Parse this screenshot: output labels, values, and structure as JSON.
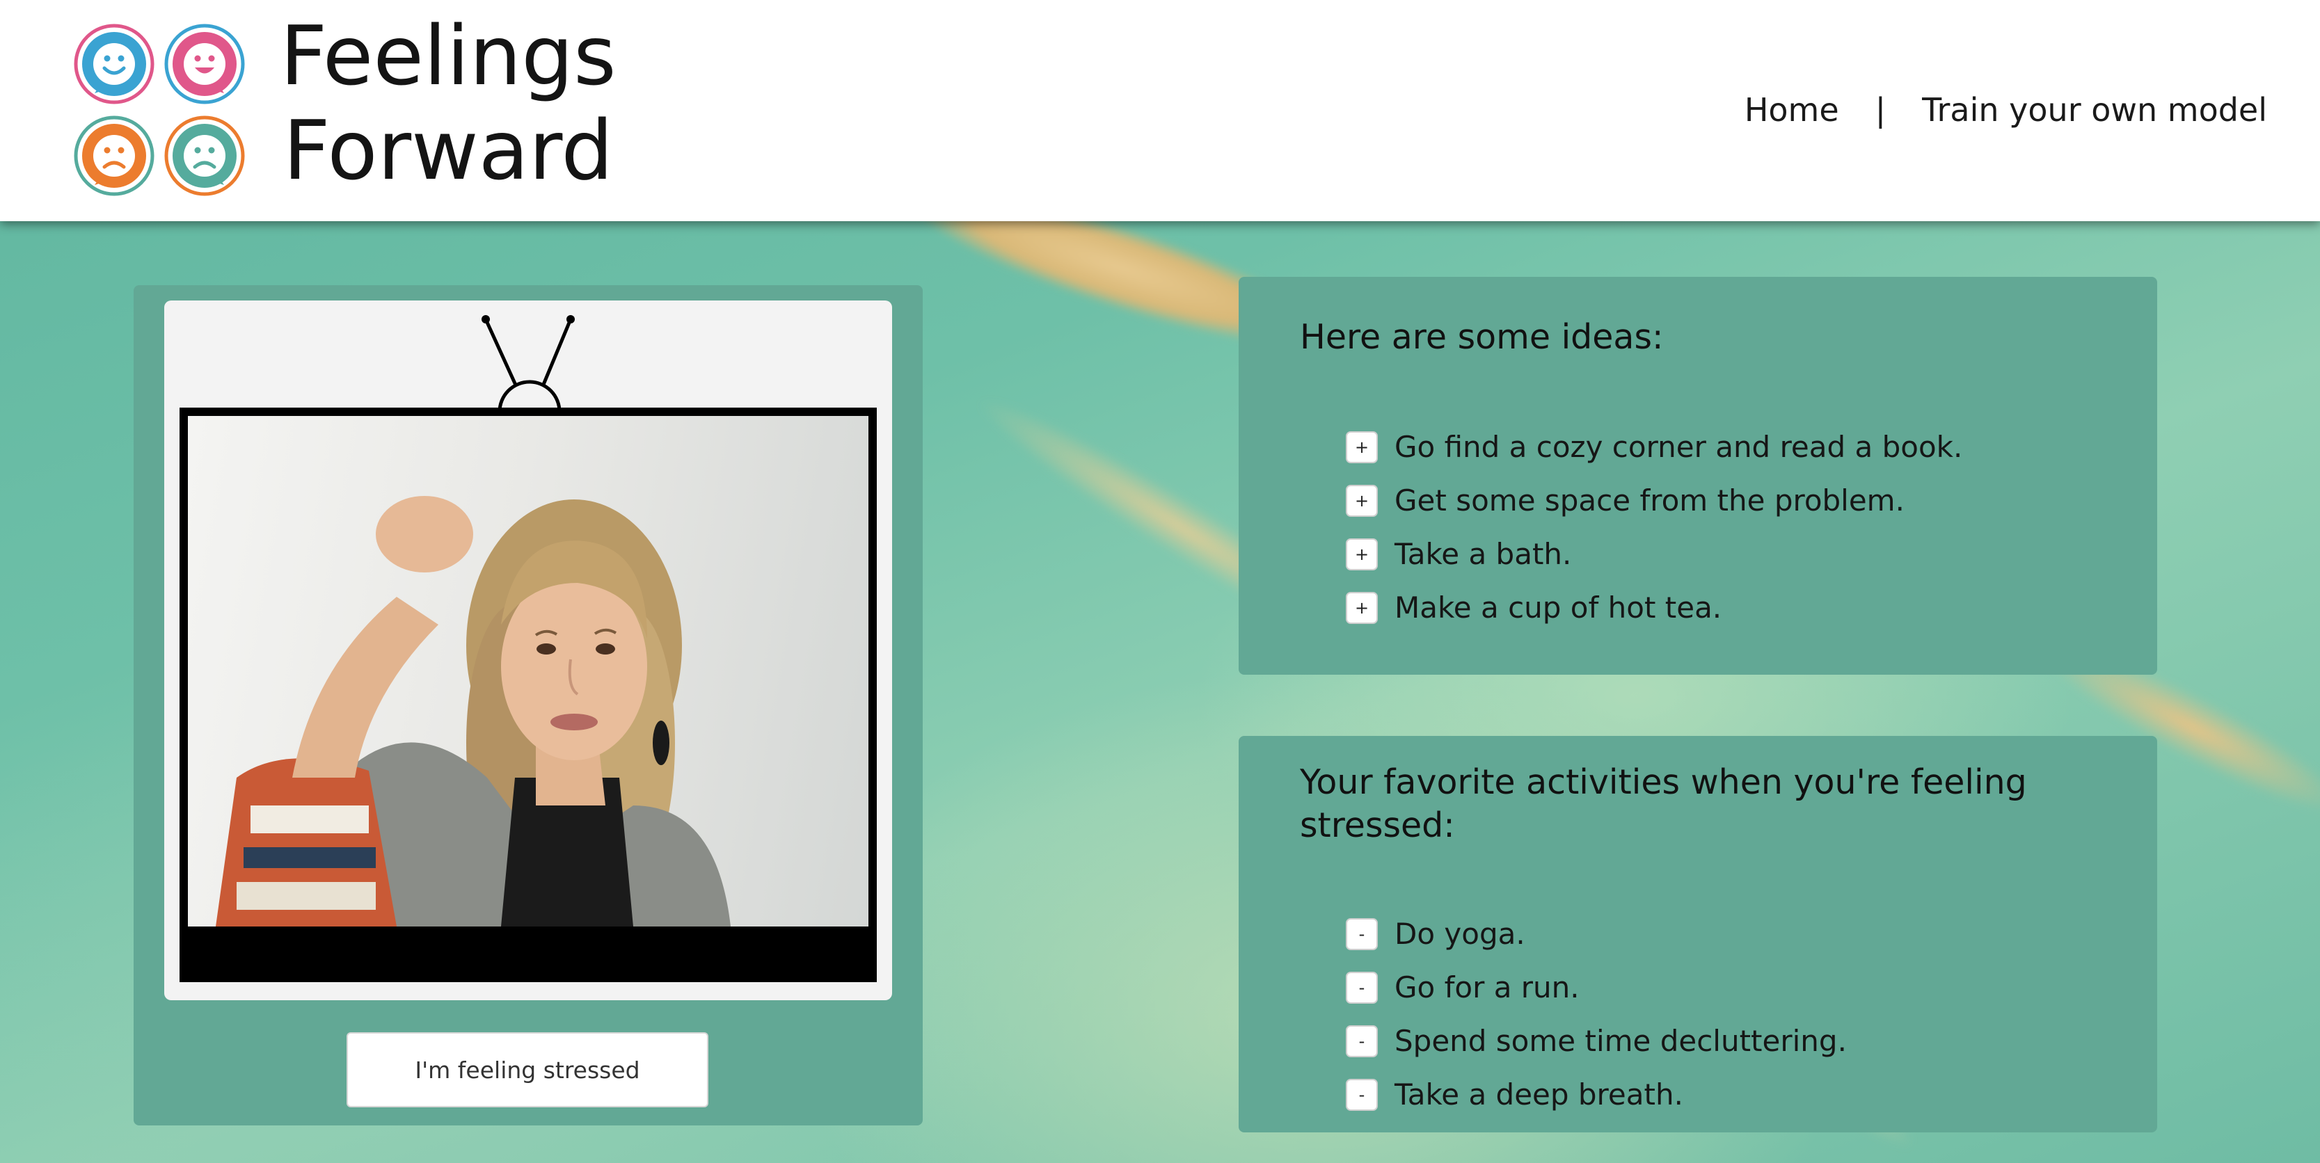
{
  "app": {
    "title_line1": "Feelings",
    "title_line2": "Forward"
  },
  "nav": {
    "home": "Home",
    "separator": "|",
    "train": "Train your own model"
  },
  "camera": {
    "feeling_button": "I'm feeling stressed"
  },
  "ideas": {
    "title": "Here are some ideas:",
    "add_symbol": "+",
    "items": [
      "Go find a cozy corner and read a book.",
      "Get some space from the problem.",
      "Take a bath.",
      "Make a cup of hot tea."
    ]
  },
  "favorites": {
    "title": "Your favorite activities when you're feeling stressed:",
    "remove_symbol": "-",
    "items": [
      "Do yoga.",
      "Go for a run.",
      "Spend some time decluttering.",
      "Take a deep breath."
    ]
  },
  "colors": {
    "card_bg": "#62a895",
    "header_bg": "#ffffff",
    "face_blue": "#3aa3d2",
    "face_pink": "#e0578a",
    "face_orange": "#ec7c2e",
    "face_teal": "#55ab9d"
  },
  "icons": [
    "happy-face-icon-blue",
    "happy-face-icon-pink",
    "sad-face-icon-orange",
    "sad-face-icon-teal",
    "tv-antenna-icon"
  ]
}
